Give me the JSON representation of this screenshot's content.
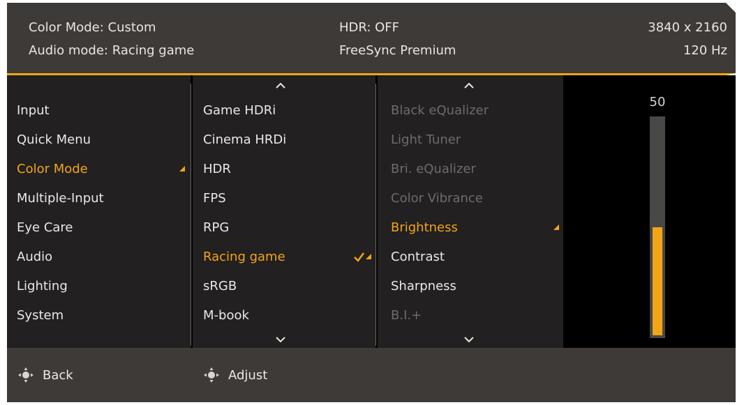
{
  "status": {
    "color_mode": "Color Mode: Custom",
    "audio_mode": "Audio mode: Racing game",
    "hdr": "HDR: OFF",
    "freesync": "FreeSync Premium",
    "resolution": "3840 x 2160",
    "refresh_rate": "120 Hz"
  },
  "main_menu": {
    "items": [
      {
        "label": "Input",
        "state": "normal"
      },
      {
        "label": "Quick Menu",
        "state": "normal"
      },
      {
        "label": "Color Mode",
        "state": "selected"
      },
      {
        "label": "Multiple-Input",
        "state": "normal"
      },
      {
        "label": "Eye Care",
        "state": "normal"
      },
      {
        "label": "Audio",
        "state": "normal"
      },
      {
        "label": "Lighting",
        "state": "normal"
      },
      {
        "label": "System",
        "state": "normal"
      }
    ]
  },
  "color_modes": {
    "items": [
      {
        "label": "Game HDRi",
        "state": "normal"
      },
      {
        "label": "Cinema HRDi",
        "state": "normal"
      },
      {
        "label": "HDR",
        "state": "normal"
      },
      {
        "label": "FPS",
        "state": "normal"
      },
      {
        "label": "RPG",
        "state": "normal"
      },
      {
        "label": "Racing game",
        "state": "selected"
      },
      {
        "label": "sRGB",
        "state": "normal"
      },
      {
        "label": "M-book",
        "state": "normal"
      }
    ]
  },
  "settings": {
    "items": [
      {
        "label": "Black eQualizer",
        "state": "disabled"
      },
      {
        "label": "Light Tuner",
        "state": "disabled"
      },
      {
        "label": "Bri. eQualizer",
        "state": "disabled"
      },
      {
        "label": "Color Vibrance",
        "state": "disabled"
      },
      {
        "label": "Brightness",
        "state": "selected"
      },
      {
        "label": "Contrast",
        "state": "normal"
      },
      {
        "label": "Sharpness",
        "state": "normal"
      },
      {
        "label": "B.I.+",
        "state": "disabled"
      }
    ]
  },
  "brightness": {
    "value": "50",
    "level": 0.5
  },
  "footer": {
    "back_label": "Back",
    "adjust_label": "Adjust"
  },
  "colors": {
    "accent": "#f2a516",
    "panel": "#3e3a38",
    "menu_bg": "#222020",
    "text": "#ebe9e6",
    "disabled_text": "#6f6c69"
  },
  "icons": [
    "chevron-up-icon",
    "chevron-down-icon",
    "checkmark-icon",
    "joystick-icon"
  ]
}
